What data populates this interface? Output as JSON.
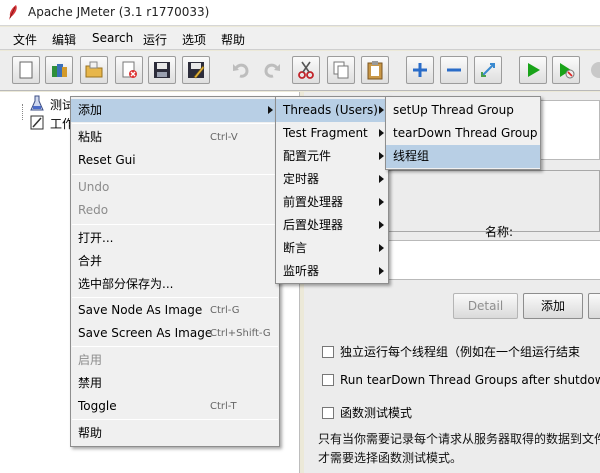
{
  "window": {
    "title": "Apache JMeter (3.1 r1770033)"
  },
  "menubar": [
    "文件",
    "编辑",
    "Search",
    "运行",
    "选项",
    "帮助"
  ],
  "toolbar": {
    "icons": [
      "new-icon",
      "templates-icon",
      "open-icon",
      "close-icon",
      "save-icon",
      "save-as-icon",
      "undo-icon",
      "redo-icon",
      "cut-icon",
      "copy-icon",
      "paste-icon",
      "expand-icon",
      "collapse-icon",
      "toggle-icon",
      "start-icon",
      "start-no-pause-icon",
      "stop-icon"
    ]
  },
  "tree": {
    "test_plan": "测试",
    "workbench": "工作"
  },
  "context_menu": {
    "items": [
      {
        "label": "添加",
        "shortcut": "",
        "submenu": true,
        "disabled": false,
        "highlighted": true
      },
      {
        "label": "粘贴",
        "shortcut": "Ctrl-V",
        "submenu": false,
        "disabled": false,
        "highlighted": false
      },
      {
        "label": "Reset Gui",
        "shortcut": "",
        "submenu": false,
        "disabled": false,
        "highlighted": false
      },
      {
        "label": "Undo",
        "shortcut": "",
        "submenu": false,
        "disabled": true,
        "highlighted": false
      },
      {
        "label": "Redo",
        "shortcut": "",
        "submenu": false,
        "disabled": true,
        "highlighted": false
      },
      {
        "label": "打开...",
        "shortcut": "",
        "submenu": false,
        "disabled": false,
        "highlighted": false
      },
      {
        "label": "合并",
        "shortcut": "",
        "submenu": false,
        "disabled": false,
        "highlighted": false
      },
      {
        "label": "选中部分保存为...",
        "shortcut": "",
        "submenu": false,
        "disabled": false,
        "highlighted": false
      },
      {
        "label": "Save Node As Image",
        "shortcut": "Ctrl-G",
        "submenu": false,
        "disabled": false,
        "highlighted": false
      },
      {
        "label": "Save Screen As Image",
        "shortcut": "Ctrl+Shift-G",
        "submenu": false,
        "disabled": false,
        "highlighted": false
      },
      {
        "label": "启用",
        "shortcut": "",
        "submenu": false,
        "disabled": true,
        "highlighted": false
      },
      {
        "label": "禁用",
        "shortcut": "",
        "submenu": false,
        "disabled": false,
        "highlighted": false
      },
      {
        "label": "Toggle",
        "shortcut": "Ctrl-T",
        "submenu": false,
        "disabled": false,
        "highlighted": false
      },
      {
        "label": "帮助",
        "shortcut": "",
        "submenu": false,
        "disabled": false,
        "highlighted": false
      }
    ]
  },
  "add_submenu": {
    "items": [
      {
        "label": "Threads (Users)",
        "highlighted": true
      },
      {
        "label": "Test Fragment",
        "highlighted": false
      },
      {
        "label": "配置元件",
        "highlighted": false
      },
      {
        "label": "定时器",
        "highlighted": false
      },
      {
        "label": "前置处理器",
        "highlighted": false
      },
      {
        "label": "后置处理器",
        "highlighted": false
      },
      {
        "label": "断言",
        "highlighted": false
      },
      {
        "label": "监听器",
        "highlighted": false
      }
    ]
  },
  "threads_submenu": {
    "items": [
      {
        "label": "setUp Thread Group",
        "highlighted": false
      },
      {
        "label": "tearDown Thread Group",
        "highlighted": false
      },
      {
        "label": "线程组",
        "highlighted": true
      }
    ]
  },
  "right_panel": {
    "name_label": "名称:",
    "detail_button": "Detail",
    "add_button": "添加",
    "checkbox_1": "独立运行每个线程组（例如在一个组运行结束",
    "checkbox_2": "Run tearDown Thread Groups after shutdown o",
    "checkbox_3": "函数测试模式",
    "note_line_1": "只有当你需要记录每个请求从服务器取得的数据到文件",
    "note_line_2": "才需要选择函数测试模式。"
  },
  "colors": {
    "menu_highlight": "#b8cfe5",
    "menu_bg": "#f0f0f0",
    "toolbar_bg": "#ededed"
  }
}
